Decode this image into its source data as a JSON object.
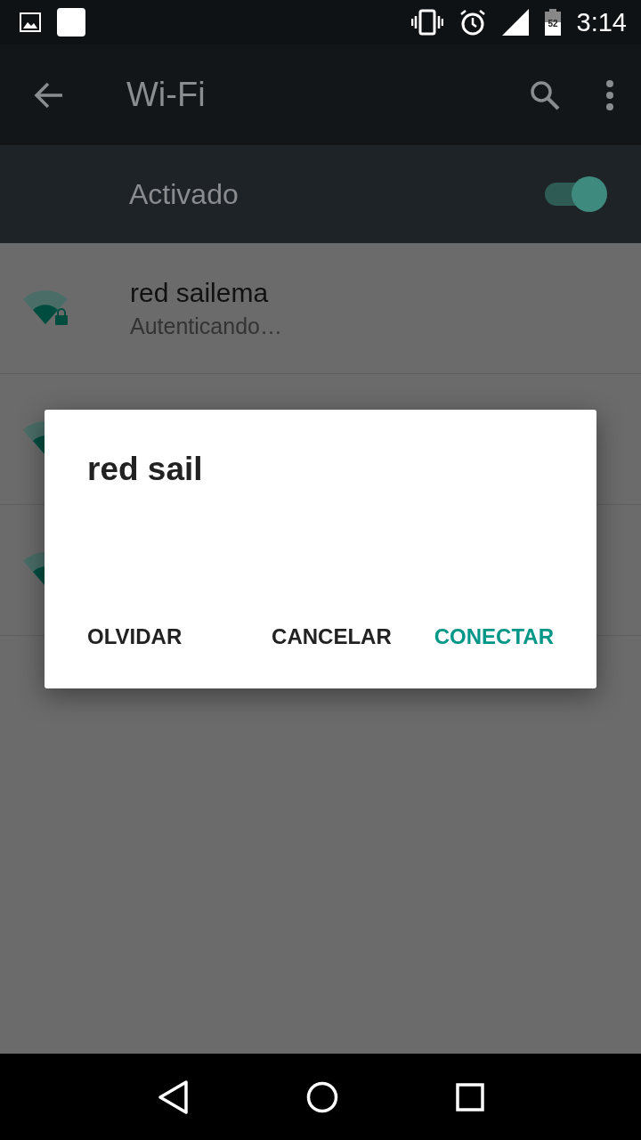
{
  "status_bar": {
    "time": "3:14",
    "battery": "52"
  },
  "toolbar": {
    "title": "Wi-Fi"
  },
  "wifi_switch": {
    "label": "Activado",
    "on": true
  },
  "networks": [
    {
      "kind": "full",
      "name": "red sailema",
      "status": "Autenticando…",
      "locked": true
    },
    {
      "kind": "covered"
    },
    {
      "kind": "covered"
    }
  ],
  "dialog": {
    "title": "red sail",
    "buttons": [
      {
        "label": "OLVIDAR",
        "kind": "neutral"
      },
      {
        "label": "CANCELAR",
        "kind": "neutral"
      },
      {
        "label": "CONECTAR",
        "kind": "primary"
      }
    ]
  }
}
